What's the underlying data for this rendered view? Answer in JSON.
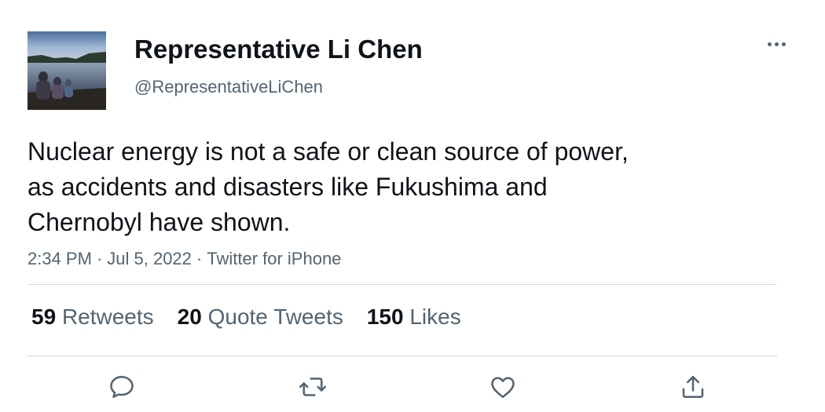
{
  "user": {
    "display_name": "Representative Li Chen",
    "handle": "@RepresentativeLiChen",
    "avatar_icon": "avatar-photo-lake-family"
  },
  "tweet": {
    "lines": [
      "Nuclear energy is not a safe or clean source of power,",
      "as accidents and disasters like Fukushima and",
      "Chernobyl have shown."
    ],
    "time": "2:34 PM",
    "date": "Jul 5, 2022",
    "source": "Twitter for iPhone",
    "separator": "·"
  },
  "stats": {
    "retweets": {
      "count": "59",
      "label": "Retweets"
    },
    "quotes": {
      "count": "20",
      "label": "Quote Tweets"
    },
    "likes": {
      "count": "150",
      "label": "Likes"
    }
  },
  "icons": {
    "more": "more-horizontal-icon",
    "reply": "reply-icon",
    "retweet": "retweet-icon",
    "like": "heart-icon",
    "share": "share-icon"
  },
  "colors": {
    "text_primary": "#0f1419",
    "text_secondary": "#536471",
    "divider": "#cfd9de"
  }
}
